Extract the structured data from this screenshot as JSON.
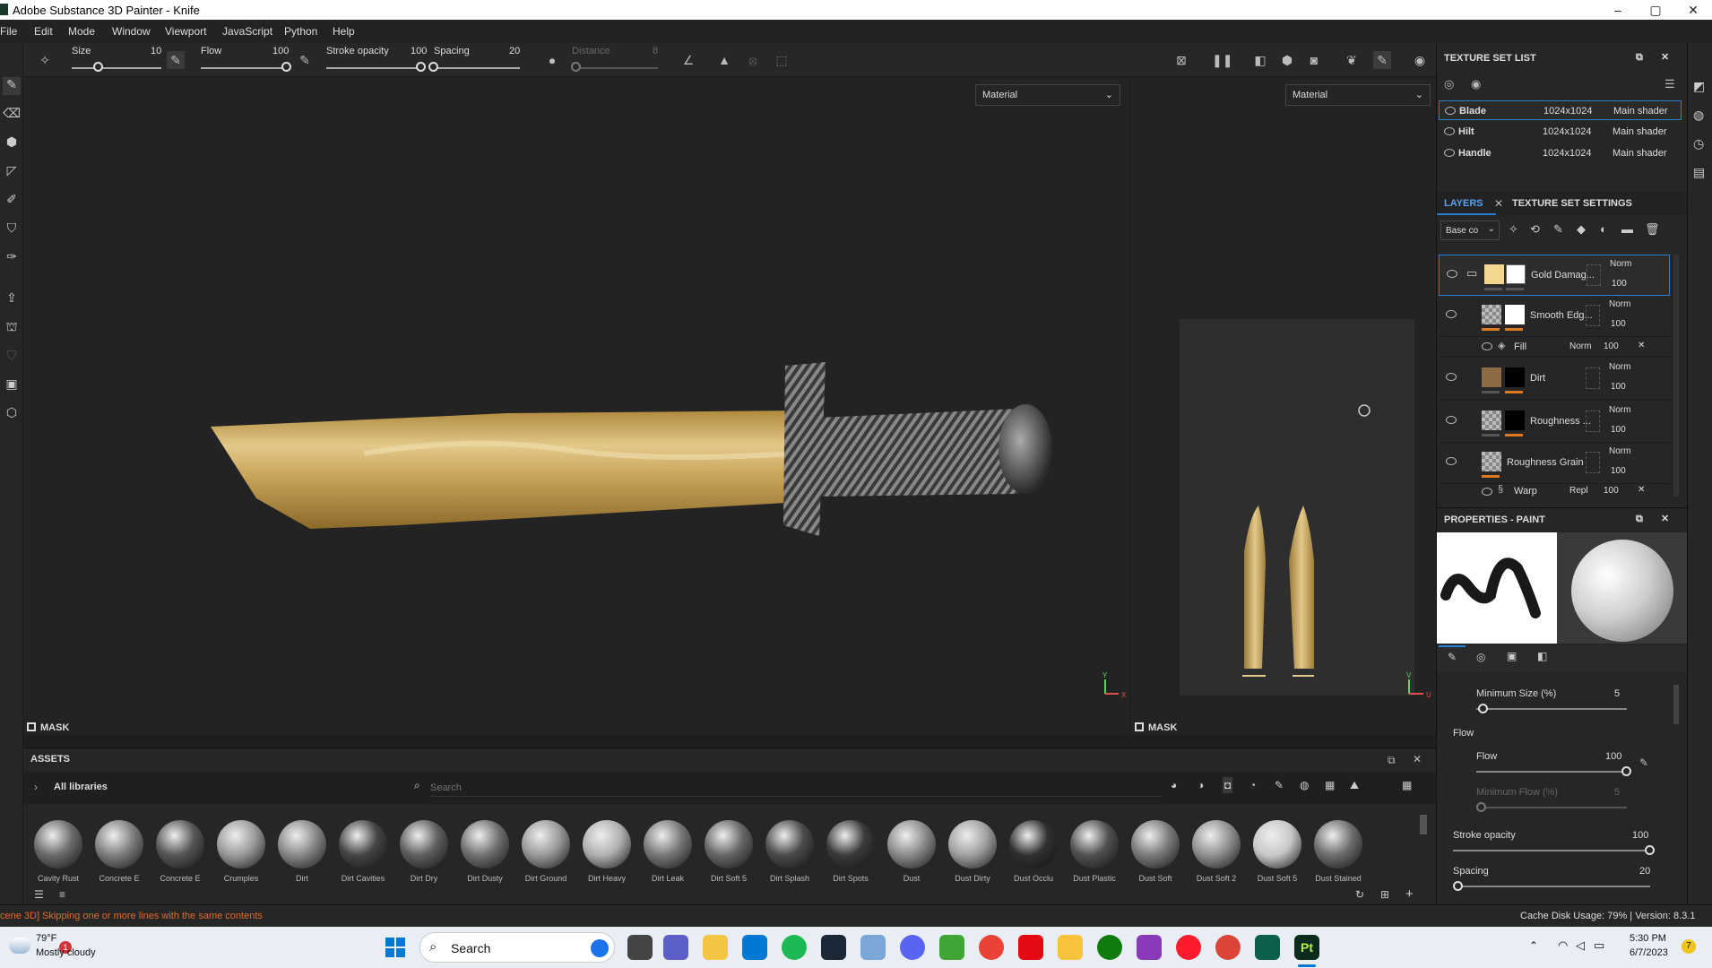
{
  "window": {
    "title": "Adobe Substance 3D Painter - Knife",
    "minimize": "–",
    "maximize": "▢",
    "close": "✕"
  },
  "menu": [
    "File",
    "Edit",
    "Mode",
    "Window",
    "Viewport",
    "JavaScript",
    "Python",
    "Help"
  ],
  "toolbar": {
    "size_label": "Size",
    "size_value": "10",
    "size_fraction": 0.3,
    "flow_label": "Flow",
    "flow_value": "100",
    "flow_fraction": 1.0,
    "stroke_opacity_label": "Stroke opacity",
    "stroke_opacity_value": "100",
    "stroke_opacity_fraction": 1.0,
    "spacing_label": "Spacing",
    "spacing_value": "20",
    "spacing_fraction": 0.0,
    "distance_label": "Distance",
    "distance_value": "8",
    "distance_fraction": 0.05
  },
  "viewports": {
    "left_material": "Material",
    "right_material": "Material",
    "mask_label": "MASK",
    "axis_y": "Y",
    "axis_x": "X",
    "axis_v": "V",
    "axis_u": "U"
  },
  "texture_set_list": {
    "title": "TEXTURE SET LIST",
    "rows": [
      {
        "name": "Blade",
        "res": "1024x1024",
        "shader": "Main shader"
      },
      {
        "name": "Hilt",
        "res": "1024x1024",
        "shader": "Main shader"
      },
      {
        "name": "Handle",
        "res": "1024x1024",
        "shader": "Main shader"
      }
    ]
  },
  "layers_panel": {
    "tab_layers": "LAYERS",
    "tab_settings": "TEXTURE SET SETTINGS",
    "channel": "Base co",
    "layers": [
      {
        "name": "Gold Damag...",
        "blend": "Norm",
        "opacity": "100"
      },
      {
        "name": "Smooth Edg...",
        "blend": "Norm",
        "opacity": "100"
      },
      {
        "name": "Fill",
        "blend": "Norm",
        "opacity": "100"
      },
      {
        "name": "Dirt",
        "blend": "Norm",
        "opacity": "100"
      },
      {
        "name": "Roughness ...",
        "blend": "Norm",
        "opacity": "100"
      },
      {
        "name": "Roughness Grain",
        "blend": "Norm",
        "opacity": "100"
      },
      {
        "name": "Warp",
        "blend": "Repl",
        "opacity": "100"
      }
    ]
  },
  "properties": {
    "title": "PROPERTIES - PAINT",
    "min_size_label": "Minimum Size (%)",
    "min_size_value": "5",
    "min_size_fraction": 0.05,
    "flow_section": "Flow",
    "flow_label": "Flow",
    "flow_value": "100",
    "flow_fraction": 1.0,
    "min_flow_label": "Minimum Flow (%)",
    "min_flow_value": "5",
    "min_flow_fraction": 0.0,
    "stroke_opacity_label": "Stroke opacity",
    "stroke_opacity_value": "100",
    "stroke_opacity_fraction": 1.0,
    "spacing_label": "Spacing",
    "spacing_value": "20",
    "spacing_fraction": 0.0
  },
  "assets": {
    "title": "ASSETS",
    "library": "All libraries",
    "search_placeholder": "Search",
    "items": [
      "Cavity Rust",
      "Concrete E",
      "Concrete E",
      "Crumples",
      "Dirt",
      "Dirt Cavities",
      "Dirt Dry",
      "Dirt Dusty",
      "Dirt Ground",
      "Dirt Heavy",
      "Dirt Leak",
      "Dirt Soft 5",
      "Dirt Splash",
      "Dirt Spots",
      "Dust",
      "Dust Dirty",
      "Dust Occlu",
      "Dust Plastic",
      "Dust Soft",
      "Dust Soft 2",
      "Dust Soft 5",
      "Dust Stained"
    ]
  },
  "status": {
    "message": "cene 3D] Skipping one or more lines with the same contents",
    "cache": "Cache Disk Usage:  79%  |  Version: 8.3.1"
  },
  "taskbar": {
    "temp": "79°F",
    "weather": "Mostly cloudy",
    "weather_badge": "1",
    "search": "Search",
    "time": "5:30 PM",
    "date": "6/7/2023",
    "notif": "7"
  },
  "colors": {
    "accent": "#2a7fd4",
    "orange": "#e07a20",
    "gold": "#c7a35a"
  }
}
